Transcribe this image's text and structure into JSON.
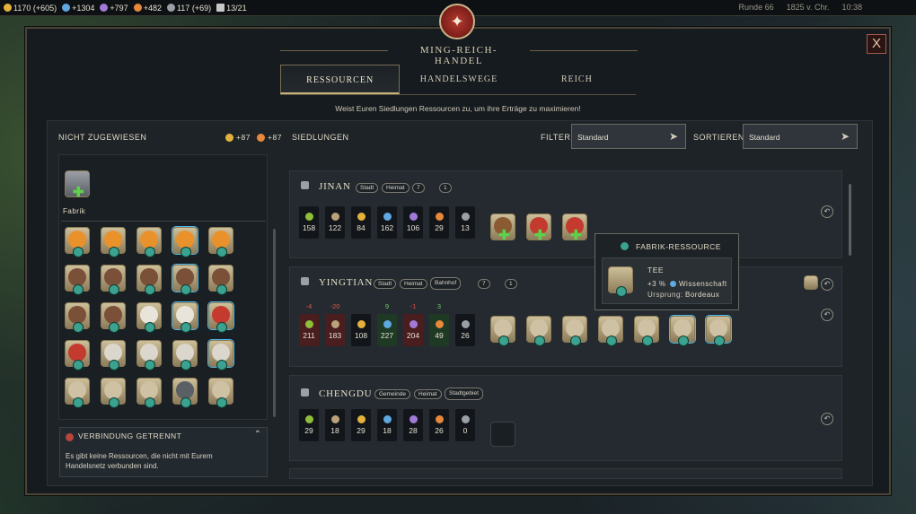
{
  "topbar": {
    "gold": "1170 (+605)",
    "science": "+1304",
    "culture": "+797",
    "happiness": "+482",
    "influence": "117 (+69)",
    "settlements": "13/21",
    "turn": "Runde 66",
    "year": "1825 v. Chr.",
    "time": "10:38"
  },
  "modal": {
    "title": "MING-REICH-HANDEL",
    "close": "X",
    "subtitle": "Weist Euren Siedlungen Ressourcen zu, um ihre Erträge zu maximieren!",
    "tabs": [
      "RESSOURCEN",
      "HANDELSWEGE",
      "REICH"
    ]
  },
  "left": {
    "header": "NICHT ZUGEWIESEN",
    "gold_bonus": "+87",
    "happy_bonus": "+87",
    "factory_label": "Fabrik",
    "disconnect_title": "VERBINDUNG GETRENNT",
    "disconnect_text": "Es gibt keine Ressourcen, die nicht mit Eurem Handelsnetz verbunden sind."
  },
  "right": {
    "header": "SIEDLUNGEN",
    "filter_label": "FILTER",
    "filter_value": "Standard",
    "sort_label": "SORTIEREN",
    "sort_value": "Standard"
  },
  "cities": [
    {
      "name": "JINAN",
      "chips": [
        "Stadt",
        "Heimat",
        "7",
        "1"
      ],
      "yields": [
        "158",
        "122",
        "84",
        "162",
        "106",
        "29",
        "13"
      ]
    },
    {
      "name": "YINGTIAN",
      "chips": [
        "Stadt",
        "Heimat",
        "Bahnhof",
        "7",
        "1"
      ],
      "yields": [
        "211",
        "183",
        "108",
        "227",
        "204",
        "49",
        "26"
      ],
      "deltas": [
        "-4",
        "-20",
        "",
        "9",
        "-1",
        "3",
        ""
      ]
    },
    {
      "name": "CHENGDU",
      "chips": [
        "Gemeinde",
        "Heimat",
        "Stadtgebiet"
      ],
      "yields": [
        "29",
        "18",
        "29",
        "18",
        "28",
        "26",
        "0"
      ]
    }
  ],
  "tooltip": {
    "header": "FABRIK-RESSOURCE",
    "name": "TEE",
    "effect_value": "+3 %",
    "effect_stat": "Wissenschaft",
    "origin_label": "Ursprung:",
    "origin_value": "Bordeaux"
  },
  "colors": {
    "food": "#8fbf3a",
    "production": "#b9a27a",
    "gold": "#e3b23c",
    "science": "#5fa8e0",
    "culture": "#a07ad6",
    "happiness": "#e8883a",
    "influence": "#9aa0a6"
  }
}
